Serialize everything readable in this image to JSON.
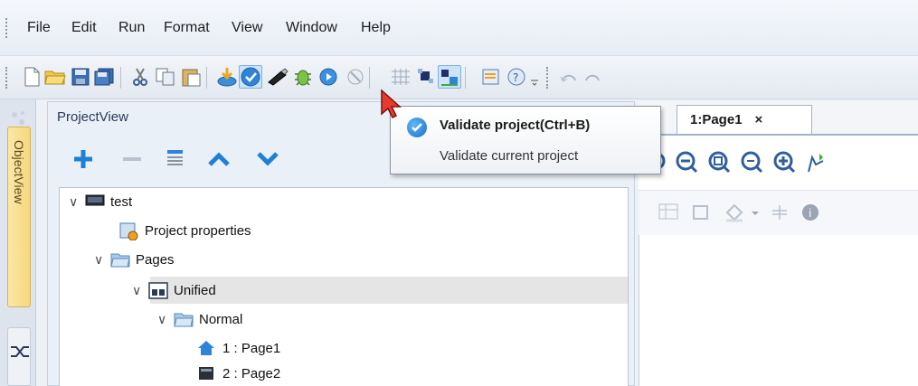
{
  "menu": {
    "items": [
      "File",
      "Edit",
      "Run",
      "Format",
      "View",
      "Window",
      "Help"
    ]
  },
  "toolbar": {
    "icons": [
      "new-file-icon",
      "open-folder-icon",
      "save-icon",
      "save-all-icon",
      "cut-icon",
      "copy-icon",
      "paste-icon",
      "download-icon",
      "validate-icon",
      "usb-icon",
      "debug-icon",
      "run-icon",
      "stop-icon",
      "grid-icon",
      "snap-icon",
      "align-icon",
      "properties-icon",
      "help-icon"
    ]
  },
  "left_tabs": {
    "objectview_label": "ObjectView"
  },
  "projectview": {
    "header": "ProjectView",
    "tools": [
      "add-icon",
      "remove-icon",
      "rename-icon",
      "move-up-icon",
      "move-down-icon"
    ],
    "tree": [
      {
        "label": "test",
        "icon": "monitor-icon",
        "expanded": true
      },
      {
        "label": "Project properties",
        "icon": "properties-icon"
      },
      {
        "label": "Pages",
        "icon": "folder-icon",
        "expanded": true
      },
      {
        "label": "Unified",
        "icon": "unified-icon",
        "expanded": true,
        "selected": true
      },
      {
        "label": "Normal",
        "icon": "folder-icon",
        "expanded": true
      },
      {
        "label": "1 : Page1",
        "icon": "home-page-icon"
      },
      {
        "label": "2 : Page2",
        "icon": "page-icon"
      }
    ]
  },
  "editor": {
    "tab_label": "1:Page1",
    "tab_close": "×"
  },
  "tooltip": {
    "title": "Validate project(Ctrl+B)",
    "description": "Validate current project"
  },
  "colors": {
    "accent": "#2f74c9",
    "plus": "#1f7fd6",
    "tab_yellow": "#f6d77b"
  }
}
